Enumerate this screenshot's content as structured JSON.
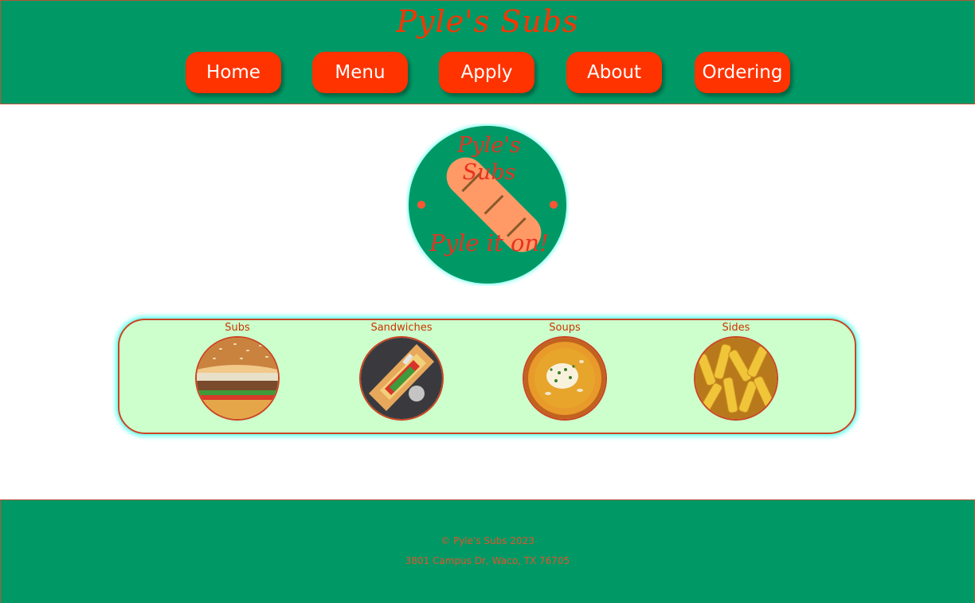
{
  "header": {
    "site_title": "Pyle's Subs",
    "nav": [
      {
        "label": "Home"
      },
      {
        "label": "Menu"
      },
      {
        "label": "Apply"
      },
      {
        "label": "About"
      },
      {
        "label": "Ordering"
      }
    ]
  },
  "logo": {
    "line1": "Pyle's",
    "line2": "Subs",
    "tagline": "Pyle it on!"
  },
  "categories": [
    {
      "label": "Subs",
      "icon": "sub-sandwich-photo"
    },
    {
      "label": "Sandwiches",
      "icon": "sandwich-photo"
    },
    {
      "label": "Soups",
      "icon": "soup-bowl-photo"
    },
    {
      "label": "Sides",
      "icon": "fries-photo"
    }
  ],
  "footer": {
    "copyright": "© Pyle's Subs 2023",
    "address": "3801 Campus Dr, Waco, TX 76705"
  },
  "colors": {
    "brand_green": "#009966",
    "accent_red": "#ff3300",
    "panel_bg": "#ccffcc",
    "glow": "#66ffee"
  }
}
